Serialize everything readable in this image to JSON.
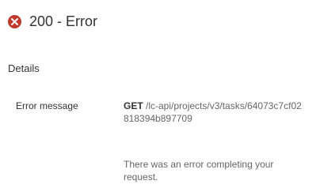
{
  "header": {
    "title": "200 - Error",
    "icon": "error-circle-icon",
    "icon_color": "#c0392b"
  },
  "details": {
    "heading": "Details",
    "error_message_label": "Error message",
    "method": "GET",
    "path": "/lc-api/projects/v3/tasks/64073c7cf02818394b897709",
    "message": "There was an error completing your request."
  }
}
